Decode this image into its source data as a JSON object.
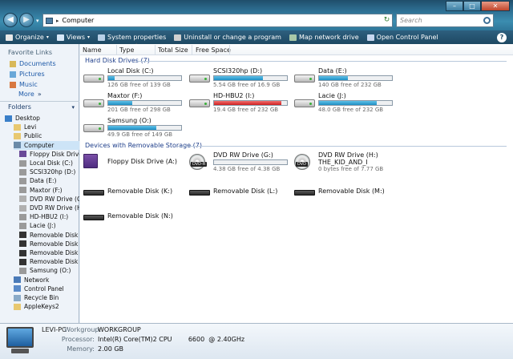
{
  "window": {
    "minimize": "–",
    "maximize": "□",
    "close": "✕"
  },
  "nav": {
    "back": "◀",
    "forward": "▶",
    "dropdown": "▾"
  },
  "address": {
    "separator": "▸",
    "path": "Computer",
    "caret": "▾",
    "refresh": "↻"
  },
  "search": {
    "placeholder": "Search"
  },
  "commands": [
    {
      "label": "Organize",
      "arrow": "▾",
      "icon_color": "#e8e8e8"
    },
    {
      "label": "Views",
      "arrow": "▾",
      "icon_color": "#d8e8f8"
    },
    {
      "label": "System properties",
      "arrow": "",
      "icon_color": "#b8d0e8"
    },
    {
      "label": "Uninstall or change a program",
      "arrow": "",
      "icon_color": "#d0d0d0"
    },
    {
      "label": "Map network drive",
      "arrow": "",
      "icon_color": "#a8c8a8"
    },
    {
      "label": "Open Control Panel",
      "arrow": "",
      "icon_color": "#c8d8f0"
    }
  ],
  "help": "?",
  "favorites": {
    "header": "Favorite Links",
    "items": [
      "Documents",
      "Pictures",
      "Music"
    ],
    "more": "More",
    "more_arrow": "»"
  },
  "folders": {
    "header": "Folders",
    "chevron": "▾"
  },
  "tree": [
    {
      "label": "Desktop",
      "color": "#3a7fc8",
      "level": 0
    },
    {
      "label": "Levi",
      "color": "#e8c870",
      "level": 1
    },
    {
      "label": "Public",
      "color": "#e8c870",
      "level": 1
    },
    {
      "label": "Computer",
      "color": "#6a8aa8",
      "level": 1,
      "selected": true
    },
    {
      "label": "Floppy Disk Drive",
      "color": "#6a4a98",
      "level": 2
    },
    {
      "label": "Local Disk (C:)",
      "color": "#9a9a9a",
      "level": 2
    },
    {
      "label": "SCSI320hp (D:)",
      "color": "#9a9a9a",
      "level": 2
    },
    {
      "label": "Data (E:)",
      "color": "#9a9a9a",
      "level": 2
    },
    {
      "label": "Maxtor (F:)",
      "color": "#9a9a9a",
      "level": 2
    },
    {
      "label": "DVD RW Drive (G:)",
      "color": "#b0b0b0",
      "level": 2
    },
    {
      "label": "DVD RW Drive (H:)",
      "color": "#b0b0b0",
      "level": 2
    },
    {
      "label": "HD-HBU2 (I:)",
      "color": "#9a9a9a",
      "level": 2
    },
    {
      "label": "Lacie (J:)",
      "color": "#9a9a9a",
      "level": 2
    },
    {
      "label": "Removable Disk (K",
      "color": "#333333",
      "level": 2
    },
    {
      "label": "Removable Disk (L",
      "color": "#333333",
      "level": 2
    },
    {
      "label": "Removable Disk (M",
      "color": "#333333",
      "level": 2
    },
    {
      "label": "Removable Disk (N",
      "color": "#333333",
      "level": 2
    },
    {
      "label": "Samsung (O:)",
      "color": "#9a9a9a",
      "level": 2
    },
    {
      "label": "Network",
      "color": "#4a7ab8",
      "level": 1
    },
    {
      "label": "Control Panel",
      "color": "#5a8ac8",
      "level": 1
    },
    {
      "label": "Recycle Bin",
      "color": "#8aaac8",
      "level": 1
    },
    {
      "label": "AppleKeys2",
      "color": "#e8c870",
      "level": 1
    }
  ],
  "columns": [
    "Name",
    "Type",
    "Total Size",
    "Free Space"
  ],
  "sort_arrow": "˄",
  "groups": {
    "hdd": "Hard Disk Drives (7)",
    "removable": "Devices with Removable Storage (7)"
  },
  "hard_drives": [
    {
      "name": "Local Disk (C:)",
      "sub": "126 GB free of 139 GB",
      "used": 0.09
    },
    {
      "name": "SCSI320hp (D:)",
      "sub": "5.54 GB free of 16.9 GB",
      "used": 0.67
    },
    {
      "name": "Data (E:)",
      "sub": "140 GB free of 232 GB",
      "used": 0.4
    },
    {
      "name": "Maxtor (F:)",
      "sub": "201 GB free of 298 GB",
      "used": 0.33
    },
    {
      "name": "HD-HBU2 (I:)",
      "sub": "19.4 GB free of 232 GB",
      "used": 0.92,
      "critical": true
    },
    {
      "name": "Lacie (J:)",
      "sub": "48.0 GB free of 232 GB",
      "used": 0.79
    },
    {
      "name": "Samsung (O:)",
      "sub": "49.9 GB free of 149 GB",
      "used": 0.66
    }
  ],
  "removable": [
    {
      "name": "Floppy Disk Drive (A:)",
      "kind": "floppy"
    },
    {
      "name": "DVD RW Drive (G:)",
      "kind": "dvd",
      "sub": "4.38 GB free of 4.38 GB",
      "used": 0.0,
      "tag": "DVD-R"
    },
    {
      "name": "DVD RW Drive (H:)",
      "name2": "THE_KID_AND_I",
      "kind": "dvd",
      "sub": "0 bytes free of 7.77 GB",
      "tag": "DVD"
    },
    {
      "name": "Removable Disk (K:)",
      "kind": "usb"
    },
    {
      "name": "Removable Disk (L:)",
      "kind": "usb"
    },
    {
      "name": "Removable Disk (M:)",
      "kind": "usb"
    },
    {
      "name": "Removable Disk (N:)",
      "kind": "usb"
    }
  ],
  "details": {
    "computer_name": "LEVI-PC",
    "workgroup_label": "Workgroup:",
    "workgroup": "WORKGROUP",
    "processor_label": "Processor:",
    "processor": "Intel(R) Core(TM)2 CPU        6600  @ 2.40GHz",
    "memory_label": "Memory:",
    "memory": "2.00 GB"
  }
}
